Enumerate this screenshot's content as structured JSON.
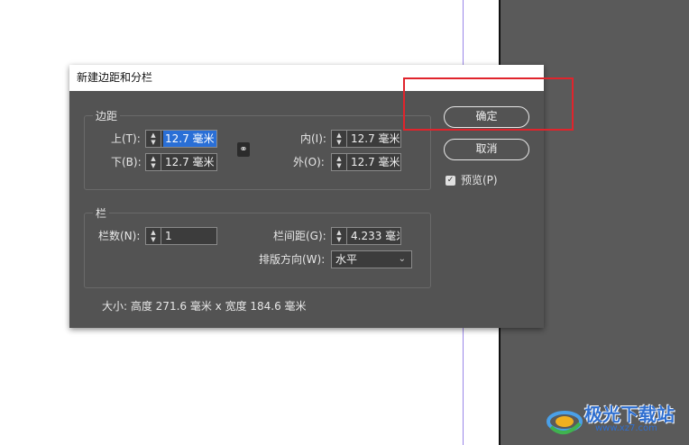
{
  "dialog": {
    "title": "新建边距和分栏",
    "margins": {
      "legend": "边距",
      "top_label": "上(T):",
      "top_value": "12.7 毫米",
      "bottom_label": "下(B):",
      "bottom_value": "12.7 毫米",
      "inside_label": "内(I):",
      "inside_value": "12.7 毫米",
      "outside_label": "外(O):",
      "outside_value": "12.7 毫米"
    },
    "columns": {
      "legend": "栏",
      "count_label": "栏数(N):",
      "count_value": "1",
      "gutter_label": "栏间距(G):",
      "gutter_value": "4.233 毫米",
      "direction_label": "排版方向(W):",
      "direction_value": "水平"
    },
    "size_info": "大小: 高度 271.6 毫米 x 宽度 184.6 毫米",
    "ok_label": "确定",
    "cancel_label": "取消",
    "preview_label": "预览(P)",
    "preview_checked": true
  },
  "icons": {
    "link": "chain-link-icon",
    "spinner": "spinner-arrows-icon",
    "dropdown": "chevron-down-icon"
  },
  "colors": {
    "dialog_bg": "#535353",
    "highlight": "#e0242c",
    "selection": "#2a6fd6"
  },
  "watermark": {
    "text": "极光下载站",
    "url": "www.xz7.com"
  }
}
